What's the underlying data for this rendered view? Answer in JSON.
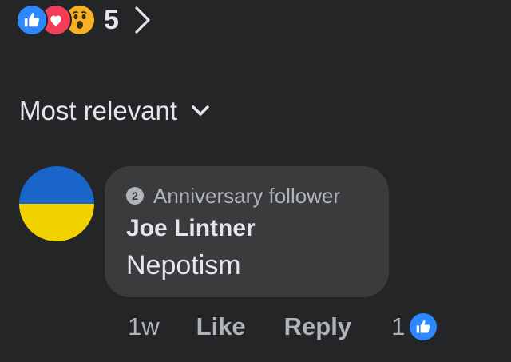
{
  "reactions": {
    "icons": [
      "thumbs-up-icon",
      "heart-icon",
      "wow-face-icon"
    ],
    "count": "5"
  },
  "sort": {
    "label": "Most relevant"
  },
  "comment": {
    "badge": "Anniversary follower",
    "badge_number": "2",
    "author": "Joe Lintner",
    "text": "Nepotism",
    "avatar": "Ukraine flag (blue over yellow)"
  },
  "actions": {
    "time": "1w",
    "like": "Like",
    "reply": "Reply",
    "like_count": "1"
  },
  "colors": {
    "background": "#242526",
    "bubble": "#3a3b3c",
    "primary_text": "#e4e6eb",
    "secondary_text": "#b0b3b8",
    "like_blue": "#2d88ff",
    "love_red": "#f33e58",
    "wow_yellow": "#f7b125",
    "flag_blue": "#1a65c9",
    "flag_yellow": "#f2d100"
  }
}
